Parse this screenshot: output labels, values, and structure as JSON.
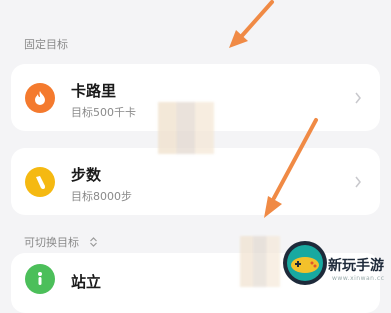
{
  "sections": {
    "fixed_goals_label": "固定目标",
    "switchable_goals_label": "可切换目标"
  },
  "cards": [
    {
      "title": "卡路里",
      "subtitle": "目标500千卡",
      "icon": "flame-icon",
      "icon_color": "#f47a2e"
    },
    {
      "title": "步数",
      "subtitle": "目标8000步",
      "icon": "footprint-icon",
      "icon_color": "#f5b912"
    },
    {
      "title": "站立",
      "subtitle": "",
      "icon": "standing-person-icon",
      "icon_color": "#4cbf5a"
    }
  ],
  "colors": {
    "background": "#f4f4f6",
    "card": "#ffffff",
    "annotation_arrow": "#f08a45"
  },
  "watermark": {
    "text": "新玩手游",
    "url": "www.xinwan.cc"
  }
}
